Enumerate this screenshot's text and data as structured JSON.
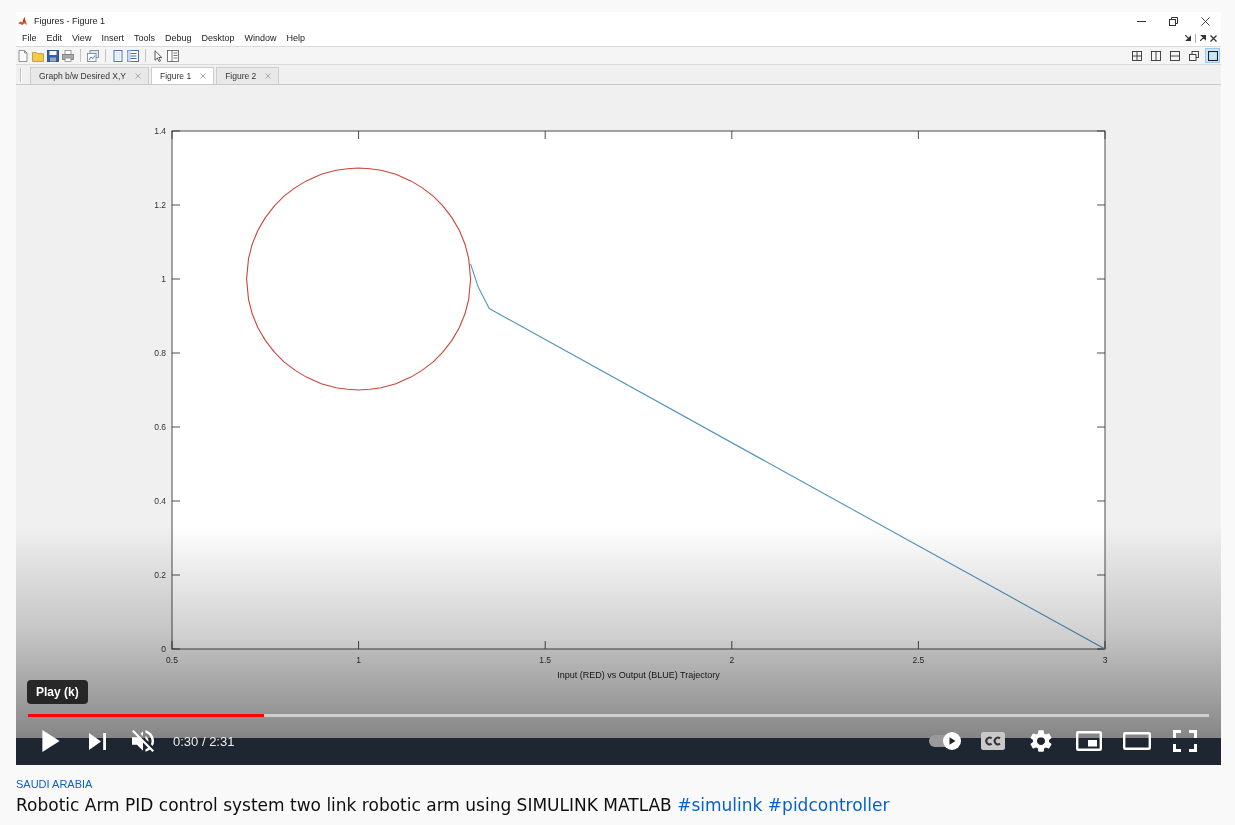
{
  "window": {
    "title": "Figures - Figure 1"
  },
  "menu": [
    "File",
    "Edit",
    "View",
    "Insert",
    "Tools",
    "Debug",
    "Desktop",
    "Window",
    "Help"
  ],
  "layout_buttons": [
    {
      "kind": "tile",
      "selected": false
    },
    {
      "kind": "columns",
      "selected": false
    },
    {
      "kind": "rows",
      "selected": false
    },
    {
      "kind": "float",
      "selected": false
    },
    {
      "kind": "maximize",
      "selected": true
    }
  ],
  "tabs": [
    {
      "label": "Graph b/w Desired X,Y",
      "selected": false
    },
    {
      "label": "Figure 1",
      "selected": true
    },
    {
      "label": "Figure 2",
      "selected": false
    }
  ],
  "figure": {
    "chart_data": {
      "type": "line",
      "xlabel": "Input (RED) vs Output (BLUE) Trajectory",
      "xlim": [
        0.5,
        3
      ],
      "ylim": [
        0,
        1.4
      ],
      "xticks": [
        0.5,
        1,
        1.5,
        2,
        2.5,
        3
      ],
      "yticks": [
        0,
        0.2,
        0.4,
        0.6,
        0.8,
        1,
        1.2,
        1.4
      ],
      "x": [
        0.7,
        0.705,
        0.715,
        0.73,
        0.75,
        0.775,
        0.8,
        0.83,
        0.86,
        0.9,
        0.94,
        0.97,
        1.0,
        1.03,
        1.06,
        1.1,
        1.14,
        1.17,
        1.2,
        1.225,
        1.25,
        1.27,
        1.285,
        1.295,
        1.3,
        1.32,
        1.35,
        3
      ],
      "series": [
        {
          "color": "#c8453a",
          "values": [
            1.0,
            1.055,
            1.094,
            1.131,
            1.166,
            1.198,
            1.224,
            1.247,
            1.265,
            1.283,
            1.294,
            1.298,
            1.3,
            1.298,
            1.294,
            1.283,
            1.265,
            1.247,
            1.224,
            1.198,
            1.166,
            1.131,
            1.094,
            1.055,
            1.0,
            null,
            null,
            null
          ]
        },
        {
          "color": "#c8453a",
          "values": [
            1.0,
            0.945,
            0.906,
            0.869,
            0.834,
            0.802,
            0.776,
            0.753,
            0.735,
            0.717,
            0.706,
            0.702,
            0.7,
            0.702,
            0.706,
            0.717,
            0.735,
            0.753,
            0.776,
            0.802,
            0.834,
            0.869,
            0.906,
            0.945,
            1.0,
            null,
            null,
            null
          ]
        },
        {
          "color": "#4f93bf",
          "values": [
            null,
            null,
            null,
            null,
            null,
            null,
            null,
            null,
            null,
            null,
            null,
            null,
            null,
            null,
            null,
            null,
            null,
            null,
            null,
            null,
            null,
            null,
            null,
            null,
            1.04,
            0.98,
            0.92,
            0
          ]
        }
      ]
    }
  },
  "player": {
    "tooltip": "Play (k)",
    "playing": false,
    "muted": true,
    "progress": {
      "level": 0.2
    },
    "time": "0:30 / 2:31",
    "autoplay": {
      "on": true
    },
    "captions": {
      "on": false
    }
  },
  "location": "SAUDI ARABIA",
  "video_title": {
    "text": "Robotic Arm PID control system two link robotic arm using SIMULINK MATLAB",
    "hashtags": [
      "#simulink",
      "#pidcontroller"
    ]
  }
}
